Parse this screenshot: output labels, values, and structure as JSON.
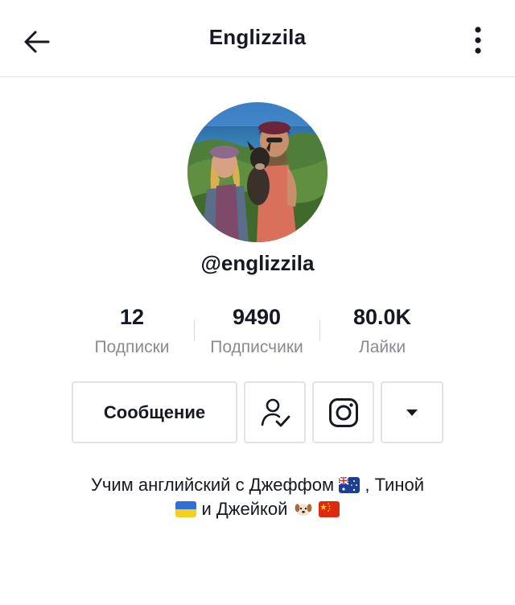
{
  "header": {
    "title": "Englizzila",
    "back_icon": "arrow-left-icon",
    "more_icon": "more-vertical-icon"
  },
  "profile": {
    "avatar_icon": "profile-photo",
    "username": "@englizzila"
  },
  "stats": [
    {
      "value": "12",
      "label": "Подписки"
    },
    {
      "value": "9490",
      "label": "Подписчики"
    },
    {
      "value": "80.0K",
      "label": "Лайки"
    }
  ],
  "actions": {
    "message_label": "Сообщение",
    "follow_icon": "user-check-icon",
    "instagram_icon": "instagram-icon",
    "dropdown_icon": "caret-down-icon"
  },
  "bio": {
    "line1_text": "Учим английский с Джеффом",
    "line1_suffix": ", Тиной",
    "line2_text": "и Джейкой",
    "emojis": [
      "australia-flag",
      "ukraine-flag",
      "dog-face",
      "china-flag"
    ]
  },
  "colors": {
    "text": "#161823",
    "secondary_text": "#8a8b91",
    "border": "#e3e3e4"
  }
}
